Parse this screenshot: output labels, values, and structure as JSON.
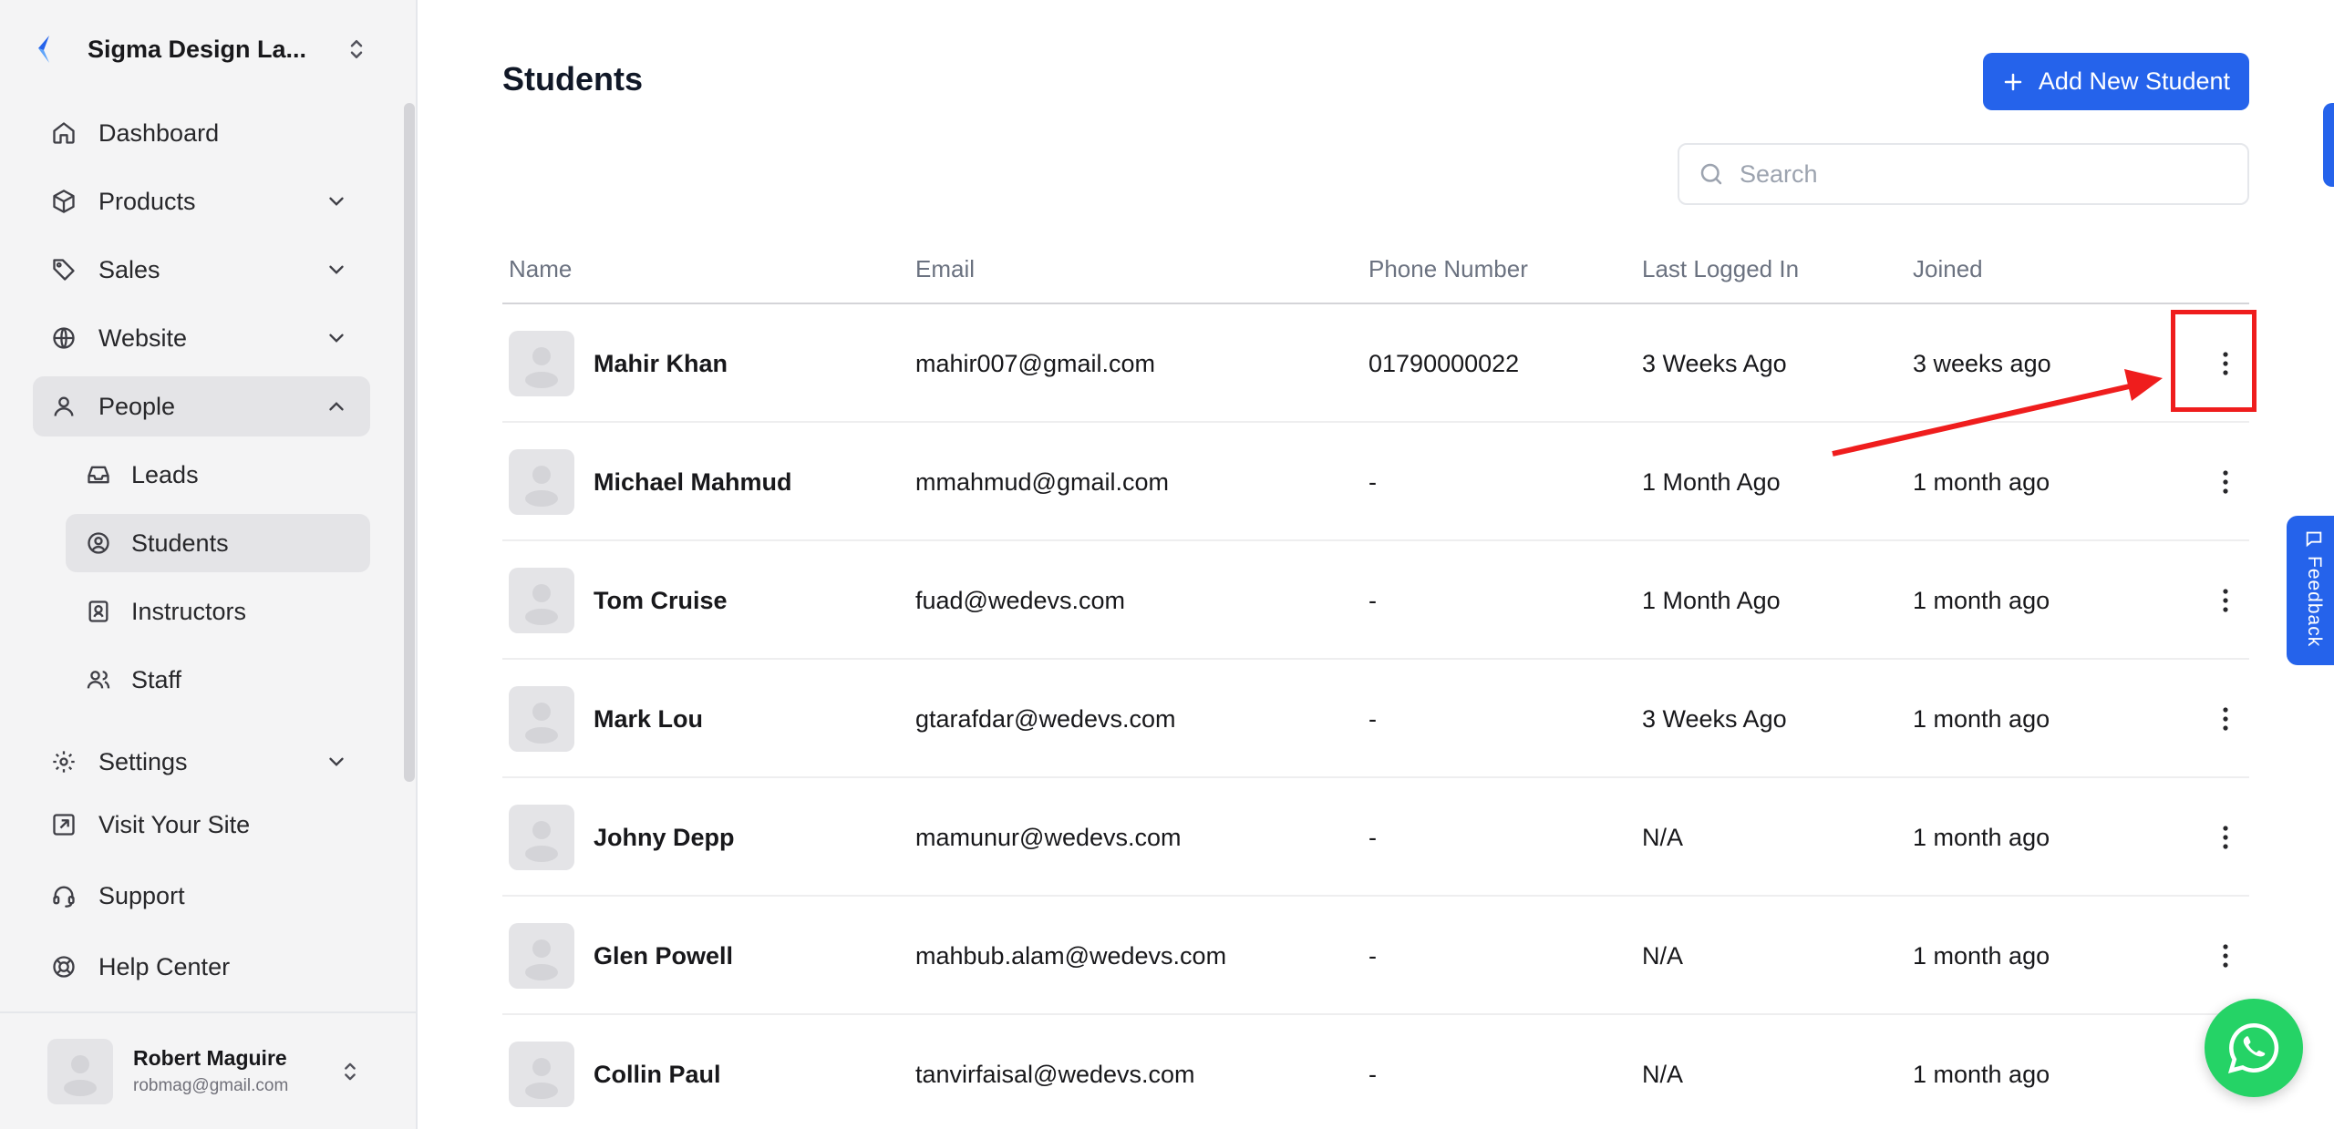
{
  "sidebar": {
    "brand_name": "Sigma Design La...",
    "nav": {
      "dashboard": "Dashboard",
      "products": "Products",
      "sales": "Sales",
      "website": "Website",
      "people": "People",
      "leads": "Leads",
      "students": "Students",
      "instructors": "Instructors",
      "staff": "Staff",
      "settings": "Settings",
      "visit_site": "Visit Your Site",
      "support": "Support",
      "help_center": "Help Center"
    },
    "user": {
      "name": "Robert Maguire",
      "email": "robmag@gmail.com"
    }
  },
  "main": {
    "title": "Students",
    "add_button": "Add New Student",
    "search_placeholder": "Search",
    "columns": {
      "name": "Name",
      "email": "Email",
      "phone": "Phone Number",
      "last": "Last Logged In",
      "joined": "Joined"
    },
    "rows": [
      {
        "name": "Mahir Khan",
        "email": "mahir007@gmail.com",
        "phone": "01790000022",
        "last": "3 Weeks Ago",
        "joined": "3 weeks ago"
      },
      {
        "name": "Michael Mahmud",
        "email": "mmahmud@gmail.com",
        "phone": "-",
        "last": "1 Month Ago",
        "joined": "1 month ago"
      },
      {
        "name": "Tom Cruise",
        "email": "fuad@wedevs.com",
        "phone": "-",
        "last": "1 Month Ago",
        "joined": "1 month ago"
      },
      {
        "name": "Mark Lou",
        "email": "gtarafdar@wedevs.com",
        "phone": "-",
        "last": "3 Weeks Ago",
        "joined": "1 month ago"
      },
      {
        "name": "Johny Depp",
        "email": "mamunur@wedevs.com",
        "phone": "-",
        "last": "N/A",
        "joined": "1 month ago"
      },
      {
        "name": "Glen Powell",
        "email": "mahbub.alam@wedevs.com",
        "phone": "-",
        "last": "N/A",
        "joined": "1 month ago"
      },
      {
        "name": "Collin Paul",
        "email": "tanvirfaisal@wedevs.com",
        "phone": "-",
        "last": "N/A",
        "joined": "1 month ago"
      }
    ]
  },
  "feedback_label": "Feedback",
  "colors": {
    "primary": "#2563eb",
    "annotation_red": "#ef1d1d",
    "whatsapp": "#25d366"
  }
}
